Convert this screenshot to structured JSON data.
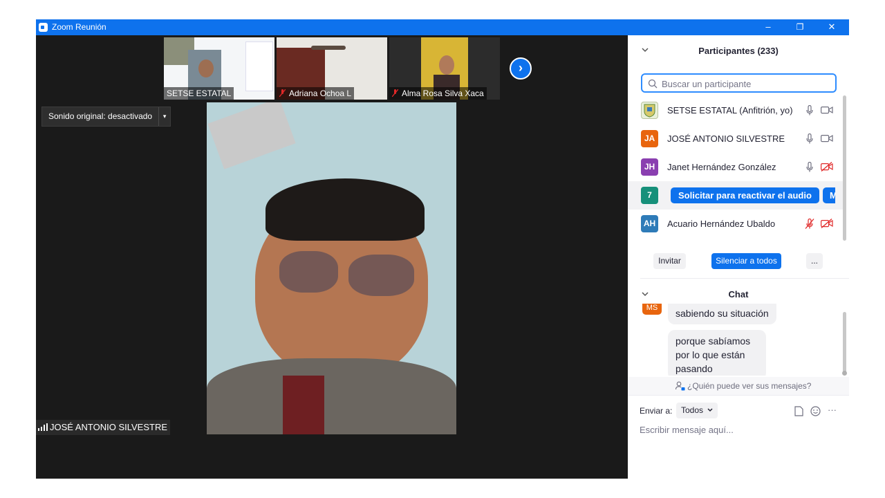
{
  "window": {
    "title": "Zoom Reunión",
    "controls": [
      "–",
      "❐",
      "✕"
    ]
  },
  "video": {
    "thumbnails": [
      {
        "name": "SETSE ESTATAL",
        "muted": false
      },
      {
        "name": "Adriana Ochoa L",
        "muted": true
      },
      {
        "name": "Alma Rosa Silva Xaca",
        "muted": true
      }
    ],
    "next_icon": "›",
    "original_sound": {
      "label": "Sonido original: desactivado",
      "caret": "▾"
    },
    "active_speaker": "JOSÉ ANTONIO SILVESTRE"
  },
  "participants": {
    "header": "Participantes (233)",
    "search_placeholder": "Buscar un participante",
    "list": [
      {
        "initials": "",
        "name": "SETSE ESTATAL (Anfitrión, yo)",
        "avatar_color": "#e9f0d9",
        "mic": "on",
        "video": "on"
      },
      {
        "initials": "JA",
        "name": "JOSÉ ANTONIO SILVESTRE",
        "avatar_color": "#e8650e",
        "mic": "on",
        "video": "on"
      },
      {
        "initials": "JH",
        "name": "Janet Hernández González",
        "avatar_color": "#8a3fb0",
        "mic": "on",
        "video": "off"
      },
      {
        "initials": "7",
        "name": "",
        "avatar_color": "#17907a",
        "mic": "",
        "video": ""
      },
      {
        "initials": "AH",
        "name": "Acuario Hernández Ubaldo",
        "avatar_color": "#2e7bb8",
        "mic": "off",
        "video": "off"
      }
    ],
    "row7_action": "Solicitar para reactivar el audio",
    "row7_more": "M",
    "buttons": {
      "invite": "Invitar",
      "mute_all": "Silenciar a todos",
      "more": "..."
    }
  },
  "chat": {
    "header": "Chat",
    "messages": [
      {
        "sender_initials": "MS",
        "text": "sabiendo su situación"
      },
      {
        "sender_initials": "",
        "text": "porque sabíamos por lo que están pasando"
      }
    ],
    "who_can_see": "¿Quién puede ver sus mensajes?",
    "send_to_label": "Enviar a:",
    "send_to_value": "Todos",
    "input_placeholder": "Escribir mensaje aquí..."
  }
}
